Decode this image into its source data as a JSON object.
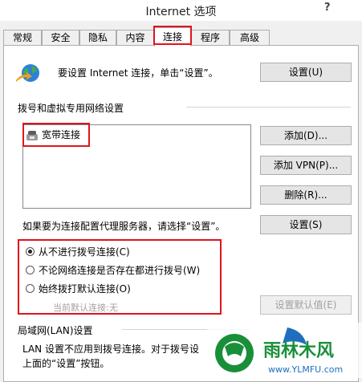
{
  "window": {
    "title": "Internet 选项",
    "help": "?"
  },
  "tabs": [
    {
      "label": "常规"
    },
    {
      "label": "安全"
    },
    {
      "label": "隐私"
    },
    {
      "label": "内容"
    },
    {
      "label": "连接"
    },
    {
      "label": "程序"
    },
    {
      "label": "高级"
    }
  ],
  "active_tab": "连接",
  "setup": {
    "text": "要设置 Internet 连接，单击“设置”。",
    "button": "设置(U)"
  },
  "dialup": {
    "group_label": "拨号和虚拟专用网络设置",
    "connections": [
      "宽带连接"
    ],
    "add_button": "添加(D)...",
    "add_vpn_button": "添加 VPN(P)...",
    "delete_button": "删除(R)...",
    "proxy_text": "如果要为连接配置代理服务器，请选择“设置”。",
    "settings_button": "设置(S)"
  },
  "dial_options": {
    "never": "从不进行拨号连接(C)",
    "when_no_network": "不论网络连接是否存在都进行拨号(W)",
    "always": "始终拨打默认连接(O)",
    "selected": "never",
    "current_default_label": "当前默认连接:",
    "current_default_value": "无",
    "set_default_button": "设置默认值(E)"
  },
  "lan": {
    "group_label": "局域网(LAN)设置",
    "text_line1": "LAN 设置不应用到拨号连接。对于拨号设",
    "text_line2": "上面的“设置”按钮。"
  },
  "watermark": {
    "brand": "雨林木风",
    "url": "www.YLMFU.com"
  },
  "colors": {
    "highlight": "#e0141b",
    "panel": "#ffffff",
    "chrome": "#f0f0f0",
    "button": "#e5e5e5",
    "watermark_green": "#1a8f3a",
    "watermark_blue": "#1f6fbd"
  }
}
